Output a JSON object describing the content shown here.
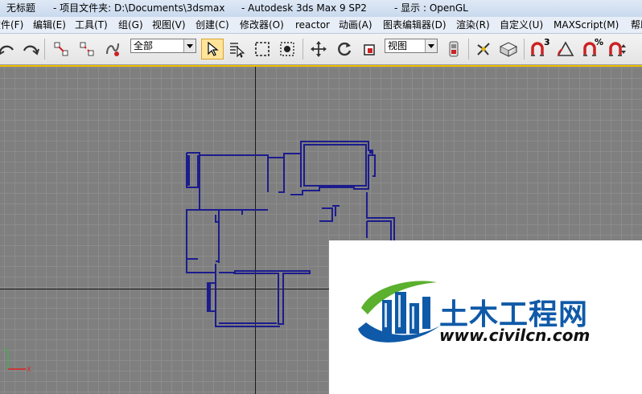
{
  "titlebar": {
    "doc_title": "无标题",
    "project_folder": "- 项目文件夹: D:\\Documents\\3dsmax",
    "app_name": "- Autodesk 3ds Max 9 SP2",
    "display_mode": "- 显示 : OpenGL"
  },
  "menu": {
    "items": [
      {
        "label": "文件(F)"
      },
      {
        "label": "编辑(E)"
      },
      {
        "label": "工具(T)"
      },
      {
        "label": "组(G)"
      },
      {
        "label": "视图(V)"
      },
      {
        "label": "创建(C)"
      },
      {
        "label": "修改器(O)"
      },
      {
        "label": "reactor"
      },
      {
        "label": "动画(A)"
      },
      {
        "label": "图表编辑器(D)"
      },
      {
        "label": "渲染(R)"
      },
      {
        "label": "自定义(U)"
      },
      {
        "label": "MAXScript(M)"
      },
      {
        "label": "帮助(H)"
      }
    ]
  },
  "toolbar": {
    "selection_filter": "全部",
    "reference_coord": "视图",
    "snap_3d_label": "3",
    "percent_snap_label": "%",
    "icons": [
      "undo-icon",
      "redo-icon",
      "link-icon",
      "unlink-icon",
      "bind-spacewarp-icon",
      "select-object-icon",
      "select-by-name-icon",
      "rectangle-region-icon",
      "window-crossing-icon",
      "select-move-icon",
      "select-rotate-icon",
      "select-scale-icon",
      "pivot-center-icon",
      "select-manipulate-icon",
      "keyboard-shortcut-icon",
      "snap-3d-icon",
      "angle-snap-icon",
      "percent-snap-icon",
      "spinner-snap-icon"
    ]
  },
  "viewport": {
    "axis_labels": {
      "x": "X",
      "y": "Y"
    },
    "colors": {
      "background": "#7f7f7f",
      "grid": "#8c8c8c",
      "home_grid_axis": "#1a1a1a",
      "wall_lines": "#1c1c8e",
      "active_border": "#f0c000"
    }
  },
  "watermark": {
    "name_cn": "土木工程网",
    "url": "www.civilcn.com",
    "colors": {
      "blue": "#0f5aa8",
      "green": "#5bb02e"
    }
  }
}
